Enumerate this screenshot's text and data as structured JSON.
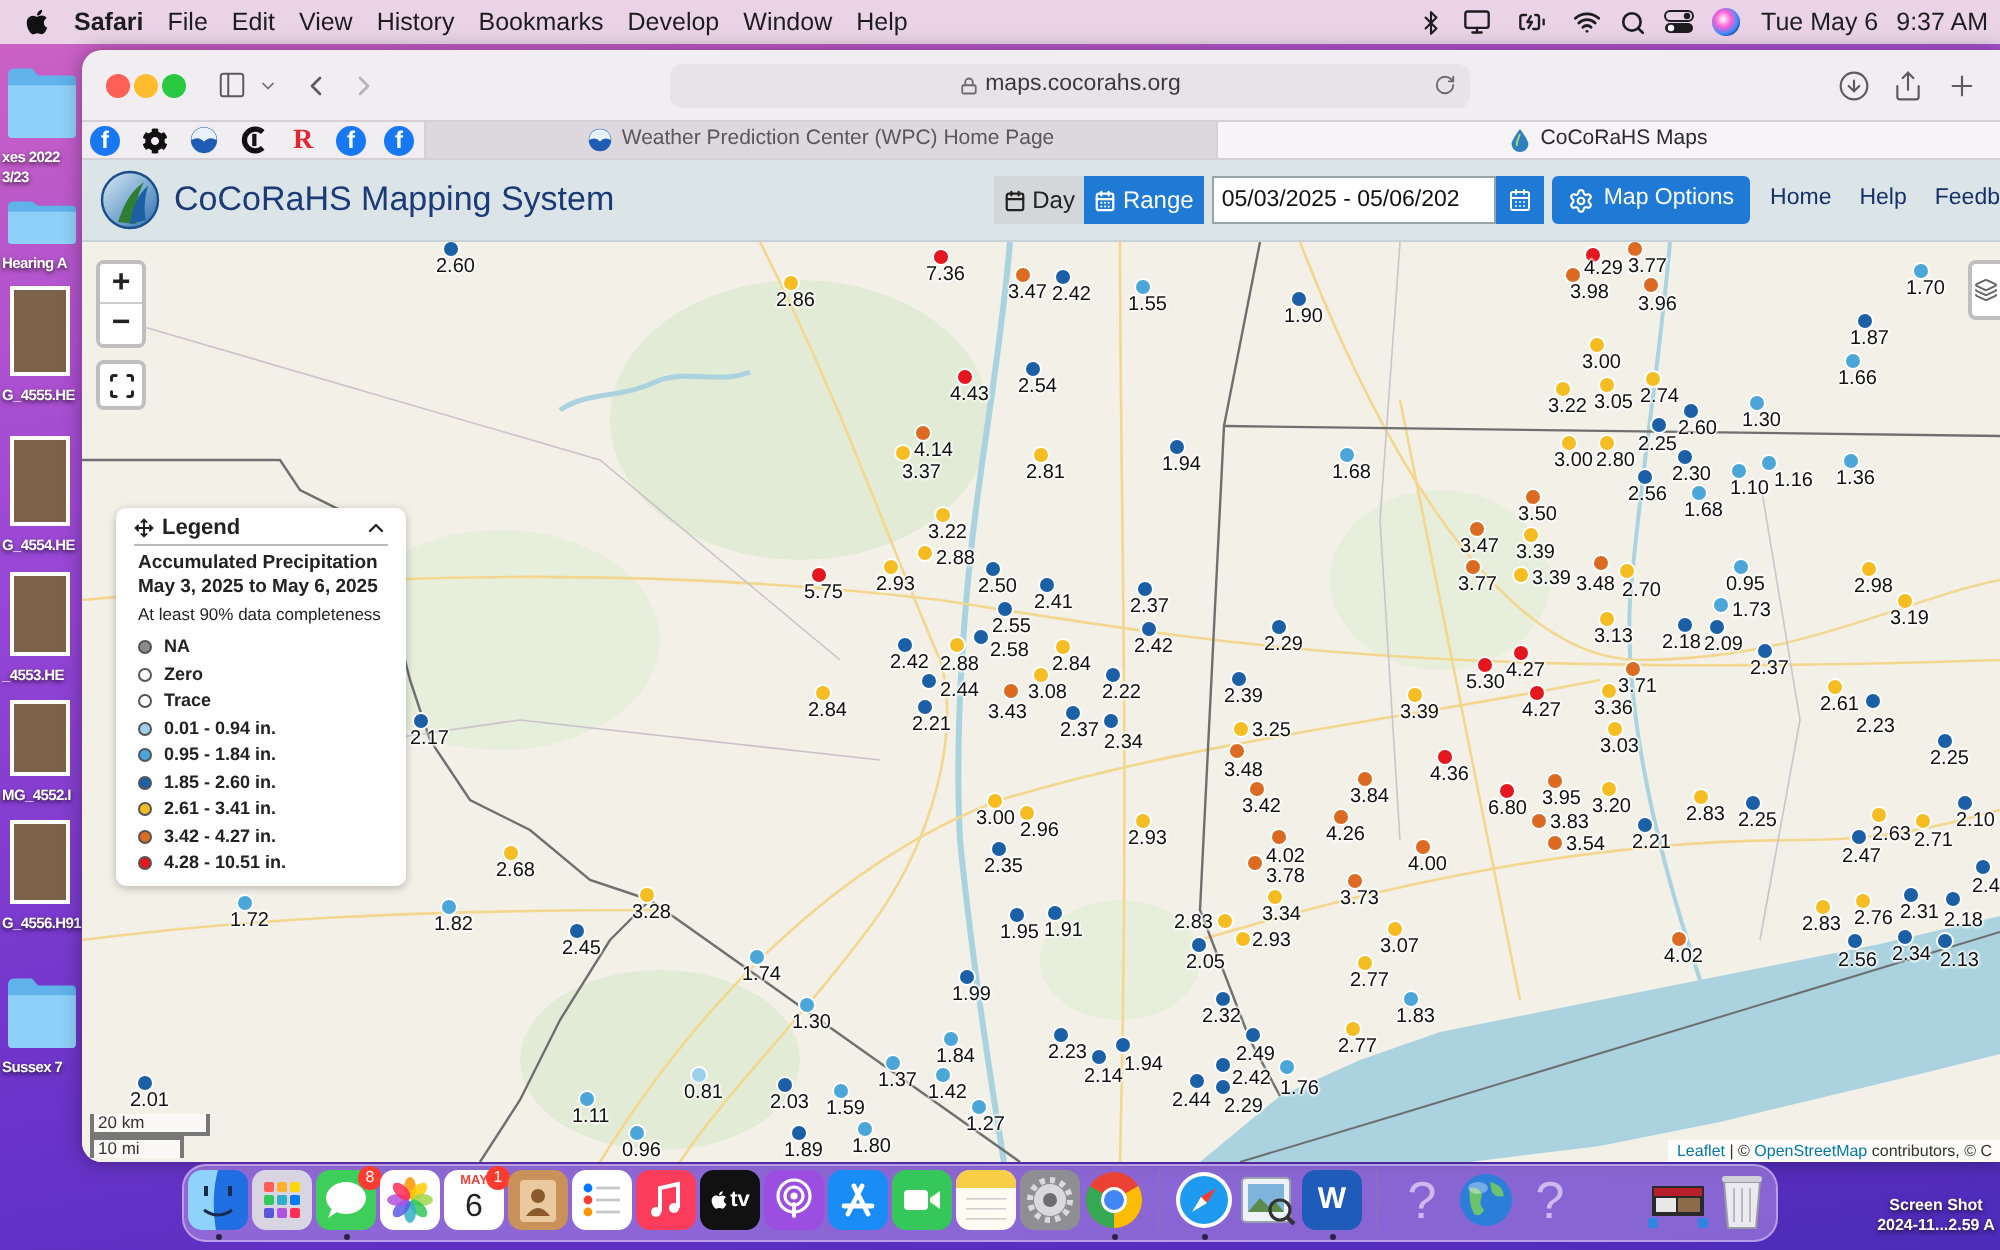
{
  "menu_bar": {
    "app": "Safari",
    "menus": [
      "File",
      "Edit",
      "View",
      "History",
      "Bookmarks",
      "Develop",
      "Window",
      "Help"
    ],
    "date": "Tue May 6",
    "time": "9:37 AM"
  },
  "desktop": {
    "icons": [
      {
        "kind": "folder",
        "label": [
          "xes 2022",
          "3/23"
        ]
      },
      {
        "kind": "folder",
        "label": [
          "Hearing A"
        ]
      },
      {
        "kind": "photo",
        "label": [
          "G_4555.HE"
        ]
      },
      {
        "kind": "photo",
        "label": [
          "G_4554.HE"
        ]
      },
      {
        "kind": "photo",
        "label": [
          "_4553.HE"
        ]
      },
      {
        "kind": "photo",
        "label": [
          "MG_4552.I"
        ]
      },
      {
        "kind": "photo",
        "label": [
          "G_4556.H91"
        ]
      },
      {
        "kind": "folder",
        "label": [
          "Sussex 7"
        ]
      }
    ],
    "corner_file": [
      "Screen Shot",
      "2024-11...2.59 A"
    ]
  },
  "browser": {
    "url": "maps.cocorahs.org",
    "favorites": [
      {
        "kind": "letter",
        "glyph": "f"
      },
      {
        "kind": "gear"
      },
      {
        "kind": "emblem"
      },
      {
        "kind": "mark"
      },
      {
        "kind": "serif",
        "glyph": "R"
      },
      {
        "kind": "letter",
        "glyph": "f"
      },
      {
        "kind": "letter",
        "glyph": "f"
      }
    ],
    "tabs": [
      {
        "title": "Weather Prediction Center (WPC) Home Page",
        "kind": "emblem",
        "selected": false
      },
      {
        "title": "CoCoRaHS Maps",
        "kind": "drop",
        "selected": true
      }
    ]
  },
  "app_header": {
    "title": "CoCoRaHS Mapping System",
    "modes": [
      {
        "label": "Day",
        "kind": "day",
        "selected": false
      },
      {
        "label": "Range",
        "kind": "range",
        "selected": true
      }
    ],
    "date_range": "05/03/2025 - 05/06/202",
    "options_button": "Map Options",
    "nav": [
      "Home",
      "Help",
      "Feedb"
    ]
  },
  "map": {
    "zoom": [
      "+",
      "−"
    ],
    "legend": {
      "title": "Legend",
      "expanded": true,
      "heading": [
        "Accumulated Precipitation",
        "May 3, 2025 to May 6, 2025"
      ],
      "note": "At least 90% data completeness",
      "items": [
        {
          "label": "NA",
          "color": "#8c8c8c"
        },
        {
          "label": "Zero",
          "color": "#ffffff"
        },
        {
          "label": "Trace",
          "color": "#ffffff"
        },
        {
          "label": "0.01 - 0.94 in.",
          "color": "#9dd0ec"
        },
        {
          "label": "0.95 - 1.84 in.",
          "color": "#4ba6d9"
        },
        {
          "label": "1.85 - 2.60 in.",
          "color": "#1b5fa6"
        },
        {
          "label": "2.61 - 3.41 in.",
          "color": "#f6bd23"
        },
        {
          "label": "3.42 - 4.27 in.",
          "color": "#dc6a20"
        },
        {
          "label": "4.28 - 10.51 in.",
          "color": "#e3171d"
        }
      ]
    },
    "stations": [
      {
        "value": "2.60",
        "color": "#1b5fa6"
      },
      {
        "value": "7.36",
        "color": "#e3171d"
      },
      {
        "value": "4.29",
        "color": "#e3171d"
      },
      {
        "value": "3.77",
        "color": "#dc6a20"
      },
      {
        "value": "2.86",
        "color": "#f6bd23"
      },
      {
        "value": "3.47",
        "color": "#dc6a20"
      },
      {
        "value": "2.42",
        "color": "#1b5fa6"
      },
      {
        "value": "1.55",
        "color": "#4ba6d9"
      },
      {
        "value": "3.98",
        "color": "#dc6a20"
      },
      {
        "value": "3.96",
        "color": "#dc6a20"
      },
      {
        "value": "1.70",
        "color": "#4ba6d9"
      },
      {
        "value": "1.90",
        "color": "#1b5fa6"
      },
      {
        "value": "1.87",
        "color": "#1b5fa6"
      },
      {
        "value": "3.00",
        "color": "#f6bd23"
      },
      {
        "value": "4.43",
        "color": "#e3171d"
      },
      {
        "value": "2.54",
        "color": "#1b5fa6"
      },
      {
        "value": "3.22",
        "color": "#f6bd23"
      },
      {
        "value": "3.05",
        "color": "#f6bd23"
      },
      {
        "value": "2.74",
        "color": "#f6bd23"
      },
      {
        "value": "1.66",
        "color": "#4ba6d9"
      },
      {
        "value": "2.60",
        "color": "#1b5fa6"
      },
      {
        "value": "1.30",
        "color": "#4ba6d9"
      },
      {
        "value": "4.14",
        "color": "#dc6a20"
      },
      {
        "value": "2.25",
        "color": "#1b5fa6"
      },
      {
        "value": "3.37",
        "color": "#f6bd23"
      },
      {
        "value": "2.81",
        "color": "#f6bd23"
      },
      {
        "value": "1.94",
        "color": "#1b5fa6"
      },
      {
        "value": "1.68",
        "color": "#4ba6d9"
      },
      {
        "value": "3.00",
        "color": "#f6bd23"
      },
      {
        "value": "2.80",
        "color": "#f6bd23"
      },
      {
        "value": "2.56",
        "color": "#1b5fa6"
      },
      {
        "value": "2.30",
        "color": "#1b5fa6"
      },
      {
        "value": "1.10",
        "color": "#4ba6d9"
      },
      {
        "value": "1.16",
        "color": "#4ba6d9"
      },
      {
        "value": "1.36",
        "color": "#4ba6d9"
      },
      {
        "value": "3.50",
        "color": "#dc6a20"
      },
      {
        "value": "1.68",
        "color": "#4ba6d9"
      },
      {
        "value": "3.22",
        "color": "#f6bd23"
      },
      {
        "value": "2.88",
        "color": "#f6bd23"
      },
      {
        "value": "3.47",
        "color": "#dc6a20"
      },
      {
        "value": "3.39",
        "color": "#f6bd23"
      },
      {
        "value": "5.75",
        "color": "#e3171d"
      },
      {
        "value": "2.93",
        "color": "#f6bd23"
      },
      {
        "value": "2.50",
        "color": "#1b5fa6"
      },
      {
        "value": "3.77",
        "color": "#dc6a20"
      },
      {
        "value": "3.39",
        "color": "#f6bd23"
      },
      {
        "value": "3.48",
        "color": "#dc6a20"
      },
      {
        "value": "2.70",
        "color": "#f6bd23"
      },
      {
        "value": "0.95",
        "color": "#4ba6d9"
      },
      {
        "value": "2.98",
        "color": "#f6bd23"
      },
      {
        "value": "2.55",
        "color": "#1b5fa6"
      },
      {
        "value": "2.41",
        "color": "#1b5fa6"
      },
      {
        "value": "2.37",
        "color": "#1b5fa6"
      },
      {
        "value": "1.73",
        "color": "#4ba6d9"
      },
      {
        "value": "3.19",
        "color": "#f6bd23"
      },
      {
        "value": "2.58",
        "color": "#1b5fa6"
      },
      {
        "value": "2.42",
        "color": "#1b5fa6"
      },
      {
        "value": "2.29",
        "color": "#1b5fa6"
      },
      {
        "value": "3.13",
        "color": "#f6bd23"
      },
      {
        "value": "2.18",
        "color": "#1b5fa6"
      },
      {
        "value": "2.09",
        "color": "#1b5fa6"
      },
      {
        "value": "2.42",
        "color": "#1b5fa6"
      },
      {
        "value": "2.88",
        "color": "#f6bd23"
      },
      {
        "value": "2.84",
        "color": "#f6bd23"
      },
      {
        "value": "4.27",
        "color": "#e3171d"
      },
      {
        "value": "2.37",
        "color": "#1b5fa6"
      },
      {
        "value": "2.84",
        "color": "#f6bd23"
      },
      {
        "value": "2.44",
        "color": "#1b5fa6"
      },
      {
        "value": "3.43",
        "color": "#dc6a20"
      },
      {
        "value": "3.08",
        "color": "#f6bd23"
      },
      {
        "value": "2.22",
        "color": "#1b5fa6"
      },
      {
        "value": "2.39",
        "color": "#1b5fa6"
      },
      {
        "value": "3.39",
        "color": "#f6bd23"
      },
      {
        "value": "5.30",
        "color": "#e3171d"
      },
      {
        "value": "4.27",
        "color": "#e3171d"
      },
      {
        "value": "3.71",
        "color": "#dc6a20"
      },
      {
        "value": "3.36",
        "color": "#f6bd23"
      },
      {
        "value": "2.61",
        "color": "#f6bd23"
      },
      {
        "value": "2.17",
        "color": "#1b5fa6"
      },
      {
        "value": "2.21",
        "color": "#1b5fa6"
      },
      {
        "value": "2.37",
        "color": "#1b5fa6"
      },
      {
        "value": "2.34",
        "color": "#1b5fa6"
      },
      {
        "value": "3.25",
        "color": "#f6bd23"
      },
      {
        "value": "3.03",
        "color": "#f6bd23"
      },
      {
        "value": "2.23",
        "color": "#1b5fa6"
      },
      {
        "value": "2.25",
        "color": "#1b5fa6"
      },
      {
        "value": "3.48",
        "color": "#dc6a20"
      },
      {
        "value": "4.36",
        "color": "#e3171d"
      },
      {
        "value": "3.00",
        "color": "#f6bd23"
      },
      {
        "value": "2.96",
        "color": "#f6bd23"
      },
      {
        "value": "2.93",
        "color": "#f6bd23"
      },
      {
        "value": "3.42",
        "color": "#dc6a20"
      },
      {
        "value": "3.84",
        "color": "#dc6a20"
      },
      {
        "value": "4.26",
        "color": "#dc6a20"
      },
      {
        "value": "6.80",
        "color": "#e3171d"
      },
      {
        "value": "3.95",
        "color": "#dc6a20"
      },
      {
        "value": "3.83",
        "color": "#dc6a20"
      },
      {
        "value": "3.20",
        "color": "#f6bd23"
      },
      {
        "value": "3.54",
        "color": "#dc6a20"
      },
      {
        "value": "2.21",
        "color": "#1b5fa6"
      },
      {
        "value": "2.83",
        "color": "#f6bd23"
      },
      {
        "value": "2.25",
        "color": "#1b5fa6"
      },
      {
        "value": "2.63",
        "color": "#f6bd23"
      },
      {
        "value": "2.71",
        "color": "#f6bd23"
      },
      {
        "value": "2.10",
        "color": "#1b5fa6"
      },
      {
        "value": "2.68",
        "color": "#f6bd23"
      },
      {
        "value": "2.35",
        "color": "#1b5fa6"
      },
      {
        "value": "4.02",
        "color": "#dc6a20"
      },
      {
        "value": "3.78",
        "color": "#dc6a20"
      },
      {
        "value": "4.00",
        "color": "#dc6a20"
      },
      {
        "value": "2.47",
        "color": "#1b5fa6"
      },
      {
        "value": "2.4",
        "color": "#1b5fa6"
      },
      {
        "value": "3.73",
        "color": "#dc6a20"
      },
      {
        "value": "1.72",
        "color": "#4ba6d9"
      },
      {
        "value": "1.82",
        "color": "#4ba6d9"
      },
      {
        "value": "3.28",
        "color": "#f6bd23"
      },
      {
        "value": "1.95",
        "color": "#1b5fa6"
      },
      {
        "value": "1.91",
        "color": "#1b5fa6"
      },
      {
        "value": "2.83",
        "color": "#f6bd23"
      },
      {
        "value": "3.34",
        "color": "#f6bd23"
      },
      {
        "value": "2.83",
        "color": "#f6bd23"
      },
      {
        "value": "2.76",
        "color": "#f6bd23"
      },
      {
        "value": "2.31",
        "color": "#1b5fa6"
      },
      {
        "value": "2.18",
        "color": "#1b5fa6"
      },
      {
        "value": "2.45",
        "color": "#1b5fa6"
      },
      {
        "value": "2.05",
        "color": "#1b5fa6"
      },
      {
        "value": "2.93",
        "color": "#f6bd23"
      },
      {
        "value": "3.07",
        "color": "#f6bd23"
      },
      {
        "value": "4.02",
        "color": "#dc6a20"
      },
      {
        "value": "2.56",
        "color": "#1b5fa6"
      },
      {
        "value": "2.34",
        "color": "#1b5fa6"
      },
      {
        "value": "2.13",
        "color": "#1b5fa6"
      },
      {
        "value": "1.74",
        "color": "#4ba6d9"
      },
      {
        "value": "2.77",
        "color": "#f6bd23"
      },
      {
        "value": "1.99",
        "color": "#1b5fa6"
      },
      {
        "value": "1.30",
        "color": "#4ba6d9"
      },
      {
        "value": "2.32",
        "color": "#1b5fa6"
      },
      {
        "value": "1.83",
        "color": "#4ba6d9"
      },
      {
        "value": "2.01",
        "color": "#1b5fa6"
      },
      {
        "value": "1.11",
        "color": "#4ba6d9"
      },
      {
        "value": "0.81",
        "color": "#9dd0ec"
      },
      {
        "value": "2.03",
        "color": "#1b5fa6"
      },
      {
        "value": "1.59",
        "color": "#4ba6d9"
      },
      {
        "value": "1.37",
        "color": "#4ba6d9"
      },
      {
        "value": "1.84",
        "color": "#4ba6d9"
      },
      {
        "value": "1.42",
        "color": "#4ba6d9"
      },
      {
        "value": "1.27",
        "color": "#4ba6d9"
      },
      {
        "value": "2.23",
        "color": "#1b5fa6"
      },
      {
        "value": "2.14",
        "color": "#1b5fa6"
      },
      {
        "value": "1.94",
        "color": "#1b5fa6"
      },
      {
        "value": "2.44",
        "color": "#1b5fa6"
      },
      {
        "value": "2.49",
        "color": "#1b5fa6"
      },
      {
        "value": "2.42",
        "color": "#1b5fa6"
      },
      {
        "value": "2.29",
        "color": "#1b5fa6"
      },
      {
        "value": "1.76",
        "color": "#4ba6d9"
      },
      {
        "value": "2.77",
        "color": "#f6bd23"
      },
      {
        "value": "0.96",
        "color": "#4ba6d9"
      },
      {
        "value": "1.89",
        "color": "#1b5fa6"
      },
      {
        "value": "1.80",
        "color": "#4ba6d9"
      }
    ],
    "scale": [
      "20 km",
      "10 mi"
    ],
    "attribution": [
      {
        "text": "Leaflet",
        "kind": "link"
      },
      {
        "text": " | © ",
        "kind": "text"
      },
      {
        "text": "OpenStreetMap",
        "kind": "link"
      },
      {
        "text": " contributors, © C",
        "kind": "text"
      }
    ]
  },
  "dock": {
    "sections": [
      [
        {
          "kind": "finder",
          "running": true
        },
        {
          "kind": "launchpad",
          "running": false
        },
        {
          "kind": "messages",
          "running": true,
          "badge": "8"
        },
        {
          "kind": "photos",
          "running": false
        },
        {
          "kind": "calendar",
          "running": false,
          "month": "MAY",
          "day": "6",
          "badge": "1"
        },
        {
          "kind": "contacts",
          "running": false
        },
        {
          "kind": "reminders",
          "running": false
        },
        {
          "kind": "music",
          "running": false
        },
        {
          "kind": "tv",
          "running": false,
          "label": "tv"
        },
        {
          "kind": "podcasts",
          "running": false
        },
        {
          "kind": "appstore",
          "running": false
        },
        {
          "kind": "facetime",
          "running": false
        },
        {
          "kind": "notes",
          "running": false
        },
        {
          "kind": "settings",
          "running": false
        },
        {
          "kind": "chrome",
          "running": true
        }
      ],
      [
        {
          "kind": "safari",
          "running": true
        },
        {
          "kind": "preview",
          "running": false
        },
        {
          "kind": "word",
          "running": true,
          "label": "W"
        }
      ],
      [
        {
          "kind": "unknown",
          "running": false,
          "label": "?"
        },
        {
          "kind": "globe",
          "running": false
        },
        {
          "kind": "unknown",
          "running": false,
          "label": "?"
        },
        {
          "kind": "screenshots",
          "running": false
        },
        {
          "kind": "trash",
          "running": false
        }
      ]
    ]
  }
}
